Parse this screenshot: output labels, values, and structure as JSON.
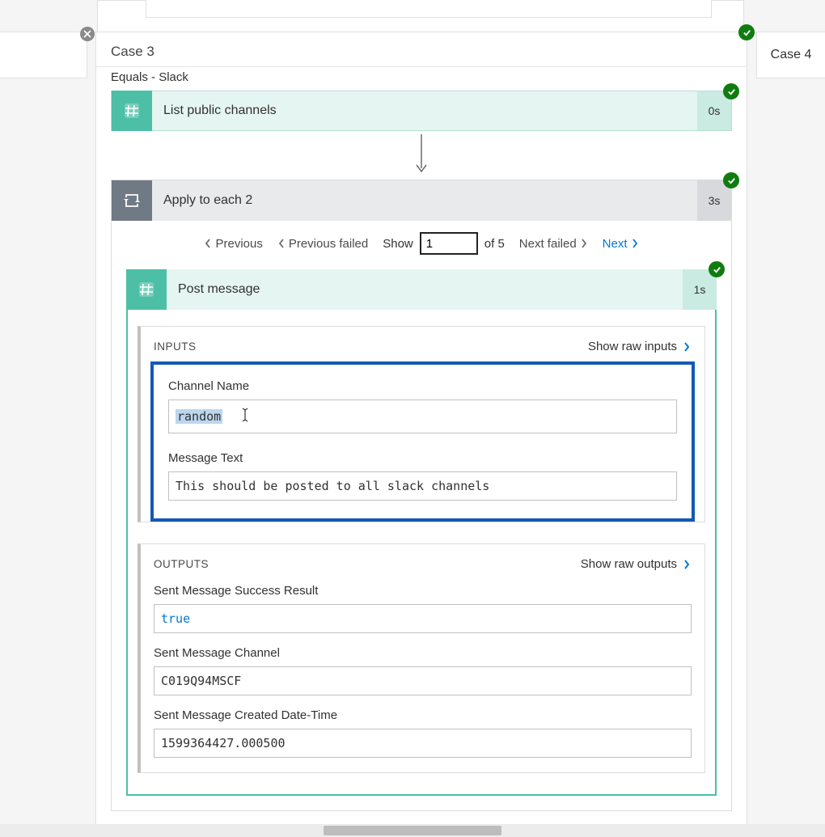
{
  "case3": {
    "title": "Case 3"
  },
  "case4": {
    "title": "Case 4"
  },
  "equals": {
    "label": "Equals - Slack"
  },
  "action_list_channels": {
    "label": "List public channels",
    "duration": "0s"
  },
  "action_apply": {
    "label": "Apply to each 2",
    "duration": "3s"
  },
  "pager": {
    "previous": "Previous",
    "previous_failed": "Previous failed",
    "show_label": "Show",
    "page_value": "1",
    "of_label": "of 5",
    "next_failed": "Next failed",
    "next": "Next"
  },
  "action_post_message": {
    "label": "Post message",
    "duration": "1s"
  },
  "inputs": {
    "section": "INPUTS",
    "show_raw": "Show raw inputs",
    "channel_name_label": "Channel Name",
    "channel_name_value": "random",
    "message_text_label": "Message Text",
    "message_text_value": "This should be posted to all slack channels"
  },
  "outputs": {
    "section": "OUTPUTS",
    "show_raw": "Show raw outputs",
    "success_label": "Sent Message Success Result",
    "success_value": "true",
    "channel_label": "Sent Message Channel",
    "channel_value": "C019Q94MSCF",
    "created_label": "Sent Message Created Date-Time",
    "created_value": "1599364427.000500"
  }
}
